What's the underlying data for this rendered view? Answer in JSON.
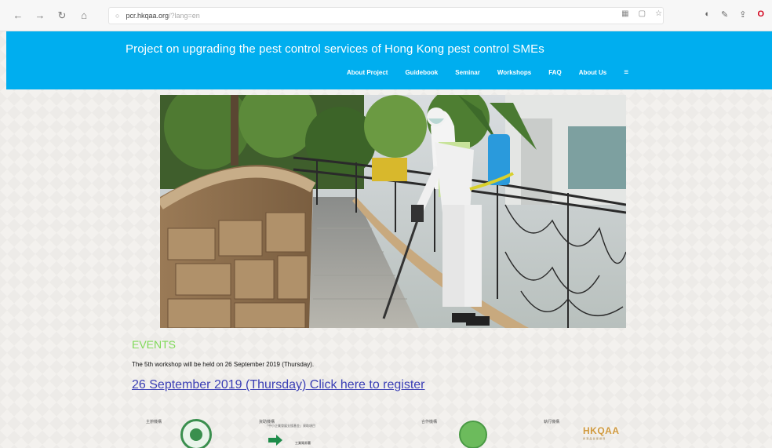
{
  "browser": {
    "url_host": "pcr.hkqaa.org",
    "url_path": "/?lang=en"
  },
  "site": {
    "title": "Project on upgrading the pest control services of Hong Kong pest control SMEs",
    "nav": [
      {
        "label": "About Project"
      },
      {
        "label": "Guidebook"
      },
      {
        "label": "Seminar"
      },
      {
        "label": "Workshops"
      },
      {
        "label": "FAQ"
      },
      {
        "label": "About Us"
      }
    ],
    "menu_icon": "≡"
  },
  "events": {
    "heading": "EVENTS",
    "text": "The 5th workshop will be held on 26 September 2019 (Thursday).",
    "link": "26 September 2019 (Thursday) Click here to register"
  },
  "sponsors": [
    {
      "label": "主辦機構"
    },
    {
      "label": "資助機構",
      "sub": "「中小企業發展支援基金」資助項目",
      "tag": "工業貿易署"
    },
    {
      "label": "合作機構"
    },
    {
      "label": "執行機構",
      "logo": "HKQAA",
      "logo_sub": "香港品質保證局"
    }
  ],
  "colors": {
    "header_bg": "#00aeef",
    "events_heading": "#7ed957",
    "link": "#3b3fb5"
  }
}
